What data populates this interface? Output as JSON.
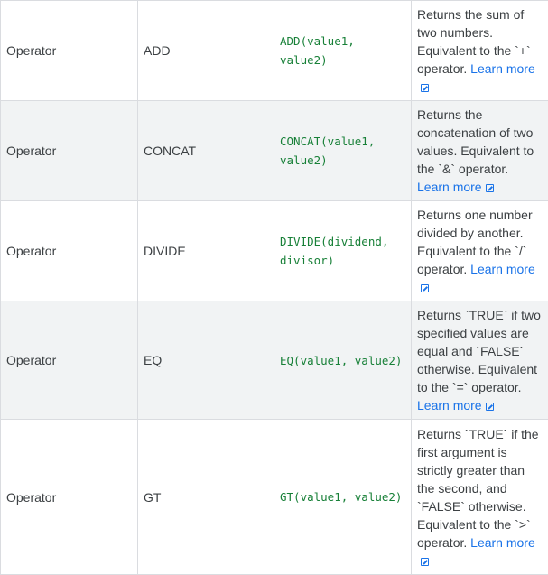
{
  "rows": [
    {
      "type": "Operator",
      "name": "ADD",
      "syntax": "ADD(value1, value2)",
      "description": "Returns the sum of two numbers. Equivalent to the `+` operator.",
      "link": "Learn more",
      "height": 111
    },
    {
      "type": "Operator",
      "name": "CONCAT",
      "syntax": "CONCAT(value1, value2)",
      "description": "Returns the concatenation of two values. Equivalent to the `&` operator.",
      "link": "Learn more",
      "height": 111
    },
    {
      "type": "Operator",
      "name": "DIVIDE",
      "syntax": "DIVIDE(dividend, divisor)",
      "description": "Returns one number divided by another. Equivalent to the `/` operator.",
      "link": "Learn more",
      "height": 111
    },
    {
      "type": "Operator",
      "name": "EQ",
      "syntax": "EQ(value1, value2)",
      "description": "Returns `TRUE` if two specified values are equal and `FALSE` otherwise. Equivalent to the `=` operator.",
      "link": "Learn more",
      "height": 131
    },
    {
      "type": "Operator",
      "name": "GT",
      "syntax": "GT(value1, value2)",
      "description": "Returns `TRUE` if the first argument is strictly greater than the second, and `FALSE` otherwise. Equivalent to the `>` operator.",
      "link": "Learn more",
      "height": 172
    }
  ],
  "colors": {
    "code": "#188038",
    "link": "#1a73e8",
    "stripe": "#f1f3f4",
    "border": "#dadce0"
  },
  "icons": {
    "link": "external-link-icon"
  }
}
